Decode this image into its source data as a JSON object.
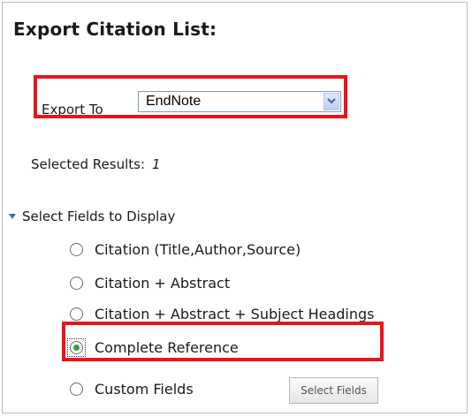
{
  "title": "Export Citation List:",
  "export": {
    "label": "Export To",
    "selected": "EndNote"
  },
  "selected_results": {
    "label": "Selected Results:",
    "count": "1"
  },
  "fields": {
    "heading": "Select Fields to Display",
    "options": [
      {
        "label": "Citation (Title,Author,Source)",
        "checked": false
      },
      {
        "label": "Citation + Abstract",
        "checked": false
      },
      {
        "label": "Citation + Abstract + Subject Headings",
        "checked": false
      },
      {
        "label": "Complete Reference",
        "checked": true
      },
      {
        "label": "Custom Fields",
        "checked": false
      }
    ],
    "select_fields_button": "Select Fields"
  },
  "colors": {
    "highlight": "#e8141b",
    "radio_selected": "#3b9c3b",
    "disclosure_triangle": "#3c6bb5"
  }
}
